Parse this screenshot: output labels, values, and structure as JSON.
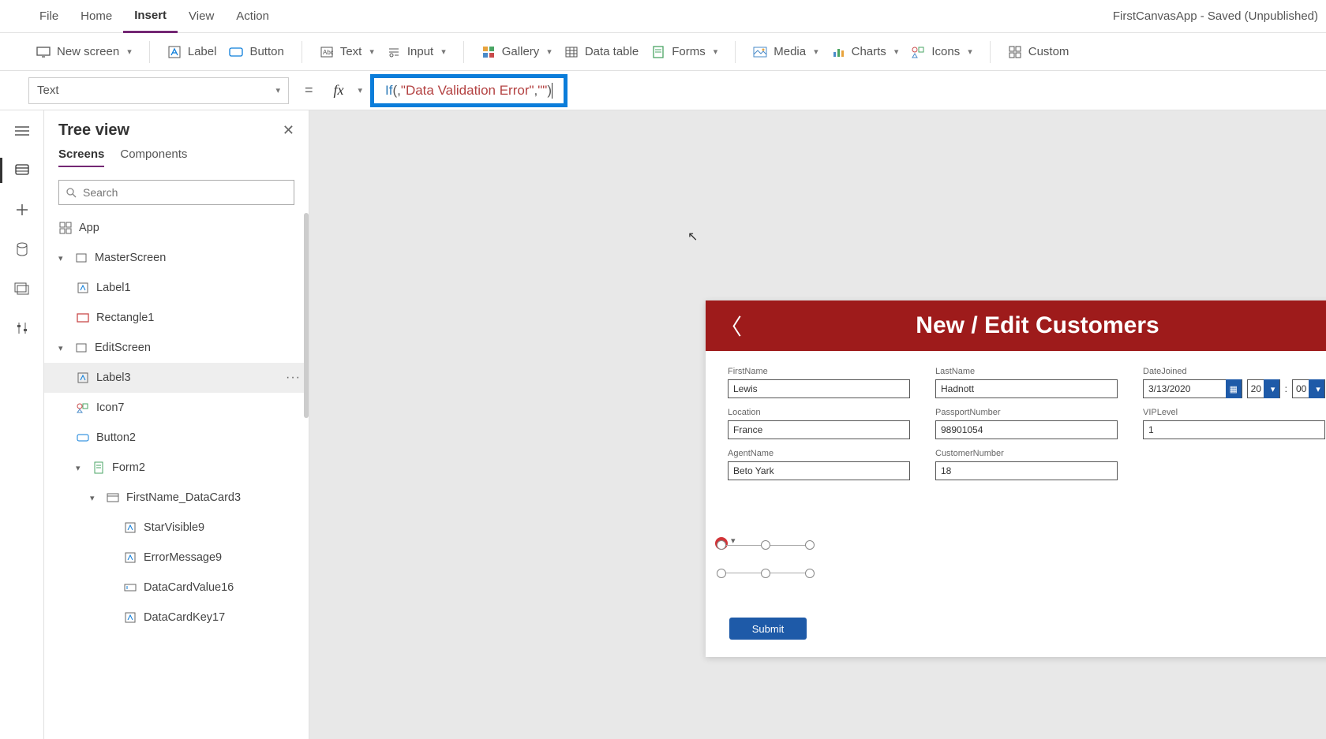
{
  "app_title": "FirstCanvasApp - Saved (Unpublished)",
  "menu": {
    "items": [
      "File",
      "Home",
      "Insert",
      "View",
      "Action"
    ],
    "active": "Insert"
  },
  "ribbon": {
    "new_screen": "New screen",
    "label": "Label",
    "button": "Button",
    "text": "Text",
    "input": "Input",
    "gallery": "Gallery",
    "data_table": "Data table",
    "forms": "Forms",
    "media": "Media",
    "charts": "Charts",
    "icons": "Icons",
    "custom": "Custom"
  },
  "formula": {
    "property": "Text",
    "fx_if": "If",
    "fx_open": "(",
    "fx_comma1": ", ",
    "fx_str1": "\"Data Validation Error\"",
    "fx_comma2": ", ",
    "fx_str2": "\"\"",
    "fx_close": ")"
  },
  "tree": {
    "title": "Tree view",
    "tabs": [
      "Screens",
      "Components"
    ],
    "active_tab": "Screens",
    "search_placeholder": "Search",
    "nodes": {
      "app": "App",
      "master": "MasterScreen",
      "label1": "Label1",
      "rect1": "Rectangle1",
      "edit": "EditScreen",
      "label3": "Label3",
      "icon7": "Icon7",
      "button2": "Button2",
      "form2": "Form2",
      "datacard": "FirstName_DataCard3",
      "star": "StarVisible9",
      "err": "ErrorMessage9",
      "dcv": "DataCardValue16",
      "dck": "DataCardKey17"
    }
  },
  "form": {
    "header_title": "New / Edit Customers",
    "fields": {
      "firstname_label": "FirstName",
      "firstname_value": "Lewis",
      "lastname_label": "LastName",
      "lastname_value": "Hadnott",
      "datejoined_label": "DateJoined",
      "date_value": "3/13/2020",
      "hour_value": "20",
      "min_value": "00",
      "time_colon": ":",
      "location_label": "Location",
      "location_value": "France",
      "passport_label": "PassportNumber",
      "passport_value": "98901054",
      "vip_label": "VIPLevel",
      "vip_value": "1",
      "agent_label": "AgentName",
      "agent_value": "Beto Yark",
      "custnum_label": "CustomerNumber",
      "custnum_value": "18"
    },
    "submit": "Submit",
    "error_x": "✕"
  }
}
